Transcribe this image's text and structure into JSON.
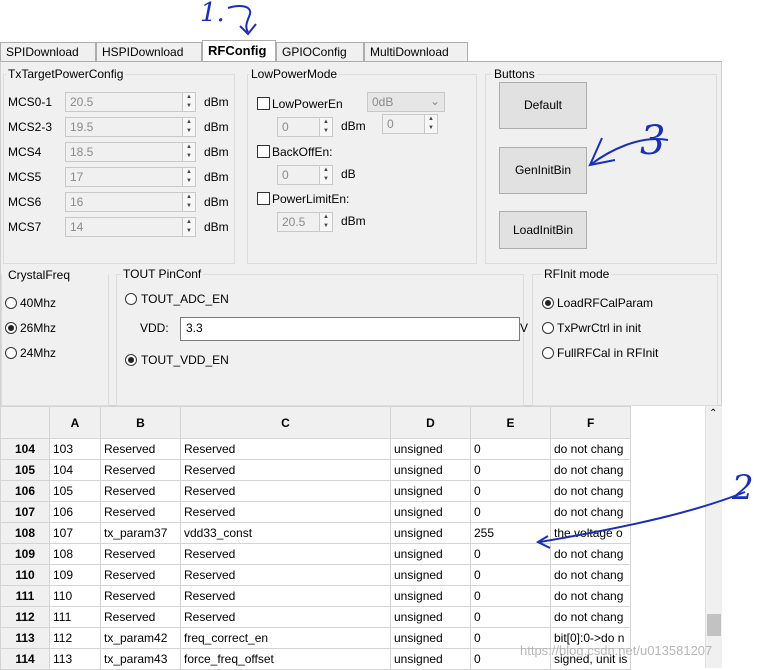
{
  "tabs": [
    {
      "label": "SPIDownload",
      "active": false
    },
    {
      "label": "HSPIDownload",
      "active": false
    },
    {
      "label": "RFConfig",
      "active": true
    },
    {
      "label": "GPIOConfig",
      "active": false
    },
    {
      "label": "MultiDownload",
      "active": false
    }
  ],
  "tx_power": {
    "title": "TxTargetPowerConfig",
    "unit": "dBm",
    "rows": [
      {
        "label": "MCS0-1",
        "value": "20.5"
      },
      {
        "label": "MCS2-3",
        "value": "19.5"
      },
      {
        "label": "MCS4",
        "value": "18.5"
      },
      {
        "label": "MCS5",
        "value": "17"
      },
      {
        "label": "MCS6",
        "value": "16"
      },
      {
        "label": "MCS7",
        "value": "14"
      }
    ]
  },
  "low_power": {
    "title": "LowPowerMode",
    "low_power_en": "LowPowerEn",
    "low_power_select": "0dB",
    "low_power_value": "0",
    "low_power_value2": "0",
    "unit_dbm": "dBm",
    "backoff_en": "BackOffEn:",
    "backoff_value": "0",
    "unit_db": "dB",
    "power_limit_en": "PowerLimitEn:",
    "power_limit_value": "20.5"
  },
  "buttons": {
    "title": "Buttons",
    "default": "Default",
    "gen_init_bin": "GenInitBin",
    "load_init_bin": "LoadInitBin"
  },
  "crystal": {
    "title": "CrystalFreq",
    "options": [
      {
        "label": "40Mhz",
        "selected": false
      },
      {
        "label": "26Mhz",
        "selected": true
      },
      {
        "label": "24Mhz",
        "selected": false
      }
    ]
  },
  "tout": {
    "title": "TOUT PinConf",
    "adc_en": "TOUT_ADC_EN",
    "vdd_label": "VDD:",
    "vdd_value": "3.3",
    "vdd_unit": "V",
    "vdd_en": "TOUT_VDD_EN"
  },
  "rfinit": {
    "title": "RFInit mode",
    "options": [
      {
        "label": "LoadRFCalParam",
        "selected": true
      },
      {
        "label": "TxPwrCtrl in init",
        "selected": false
      },
      {
        "label": "FullRFCal in RFInit",
        "selected": false
      }
    ]
  },
  "grid": {
    "columns": [
      "A",
      "B",
      "C",
      "D",
      "E",
      "F"
    ],
    "rows": [
      {
        "h": "104",
        "cells": [
          "103",
          "Reserved",
          "Reserved",
          "unsigned",
          "0",
          "do not chang"
        ]
      },
      {
        "h": "105",
        "cells": [
          "104",
          "Reserved",
          "Reserved",
          "unsigned",
          "0",
          "do not chang"
        ]
      },
      {
        "h": "106",
        "cells": [
          "105",
          "Reserved",
          "Reserved",
          "unsigned",
          "0",
          "do not chang"
        ]
      },
      {
        "h": "107",
        "cells": [
          "106",
          "Reserved",
          "Reserved",
          "unsigned",
          "0",
          "do not chang"
        ]
      },
      {
        "h": "108",
        "cells": [
          "107",
          "tx_param37",
          "vdd33_const",
          "unsigned",
          "255",
          "the voltage o"
        ]
      },
      {
        "h": "109",
        "cells": [
          "108",
          "Reserved",
          "Reserved",
          "unsigned",
          "0",
          "do not chang"
        ]
      },
      {
        "h": "110",
        "cells": [
          "109",
          "Reserved",
          "Reserved",
          "unsigned",
          "0",
          "do not chang"
        ]
      },
      {
        "h": "111",
        "cells": [
          "110",
          "Reserved",
          "Reserved",
          "unsigned",
          "0",
          "do not chang"
        ]
      },
      {
        "h": "112",
        "cells": [
          "111",
          "Reserved",
          "Reserved",
          "unsigned",
          "0",
          "do not chang"
        ]
      },
      {
        "h": "113",
        "cells": [
          "112",
          "tx_param42",
          "freq_correct_en",
          "unsigned",
          "0",
          "bit[0]:0->do n"
        ]
      },
      {
        "h": "114",
        "cells": [
          "113",
          "tx_param43",
          "force_freq_offset",
          "unsigned",
          "0",
          "signed, unit is"
        ]
      }
    ]
  },
  "annotations": {
    "step1": "1.",
    "step2": "2",
    "step3": "3",
    "ink_color": "#1a2fb8"
  },
  "watermark": "https://blog.csdn.net/u013581207"
}
